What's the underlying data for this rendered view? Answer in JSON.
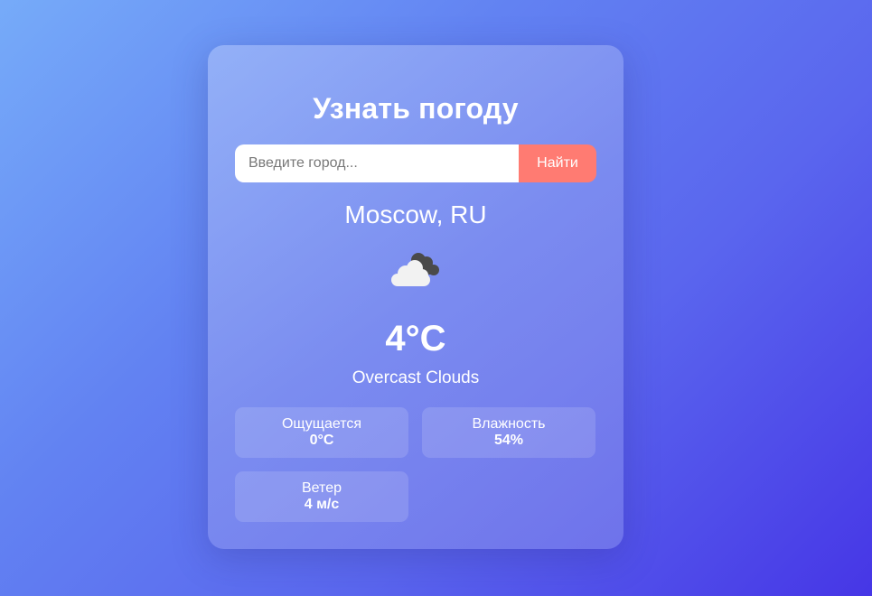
{
  "app": {
    "title": "Узнать погоду"
  },
  "search": {
    "placeholder": "Введите город...",
    "value": "",
    "button_label": "Найти"
  },
  "weather": {
    "city": "Moscow, RU",
    "icon": "overcast-clouds-icon",
    "temperature": "4°C",
    "description": "Overcast Clouds"
  },
  "details": [
    {
      "label": "Ощущается",
      "value": "0°C"
    },
    {
      "label": "Влажность",
      "value": "54%"
    },
    {
      "label": "Ветер",
      "value": "4 м/с"
    }
  ],
  "colors": {
    "accent_button": "#ff7b72",
    "text": "#ffffff"
  }
}
